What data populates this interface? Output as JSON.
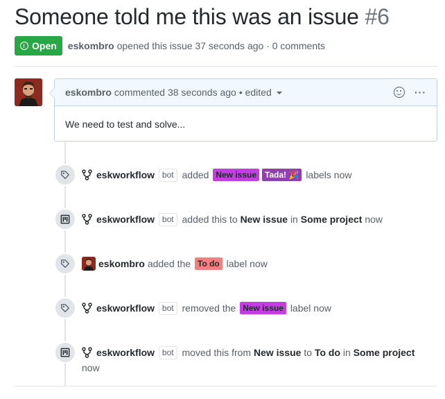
{
  "issue": {
    "title": "Someone told me this was an issue",
    "number": "#6",
    "state": "Open",
    "author": "eskombro",
    "meta": "opened this issue 37 seconds ago · 0 comments"
  },
  "comment": {
    "author": "eskombro",
    "time": "commented 38 seconds ago",
    "edited": "• edited",
    "body": "We need to test and solve...",
    "more": "···"
  },
  "events": [
    {
      "icon": "tag-icon",
      "actor": "eskworkflow",
      "bot": "bot",
      "pre": "added",
      "labels": [
        {
          "text": "New issue",
          "bg": "#c43fe1",
          "fg": "#24292e"
        },
        {
          "text": "Tada! 🎉",
          "bg": "#8f3fae",
          "fg": "#ffffff"
        }
      ],
      "post": "labels now"
    },
    {
      "icon": "project-icon",
      "actor": "eskworkflow",
      "bot": "bot",
      "pre": "added this to",
      "column": "New issue",
      "mid": "in",
      "project": "Some project",
      "post": "now"
    },
    {
      "icon": "tag-icon",
      "actor": "eskombro",
      "pre": "added the",
      "labels": [
        {
          "text": "To do",
          "bg": "#f28080",
          "fg": "#24292e"
        }
      ],
      "post": "label now"
    },
    {
      "icon": "tag-icon",
      "actor": "eskworkflow",
      "bot": "bot",
      "pre": "removed the",
      "labels": [
        {
          "text": "New issue",
          "bg": "#c43fe1",
          "fg": "#24292e"
        }
      ],
      "post": "label now"
    },
    {
      "icon": "project-icon",
      "actor": "eskworkflow",
      "bot": "bot",
      "pre": "moved this from",
      "from": "New issue",
      "to_word": "to",
      "to": "To do",
      "mid": "in",
      "project": "Some project",
      "post": "now"
    }
  ],
  "colors": {
    "open": "#28a745",
    "comment_header": "#f1f8ff",
    "comment_border": "#c0d3eb"
  }
}
